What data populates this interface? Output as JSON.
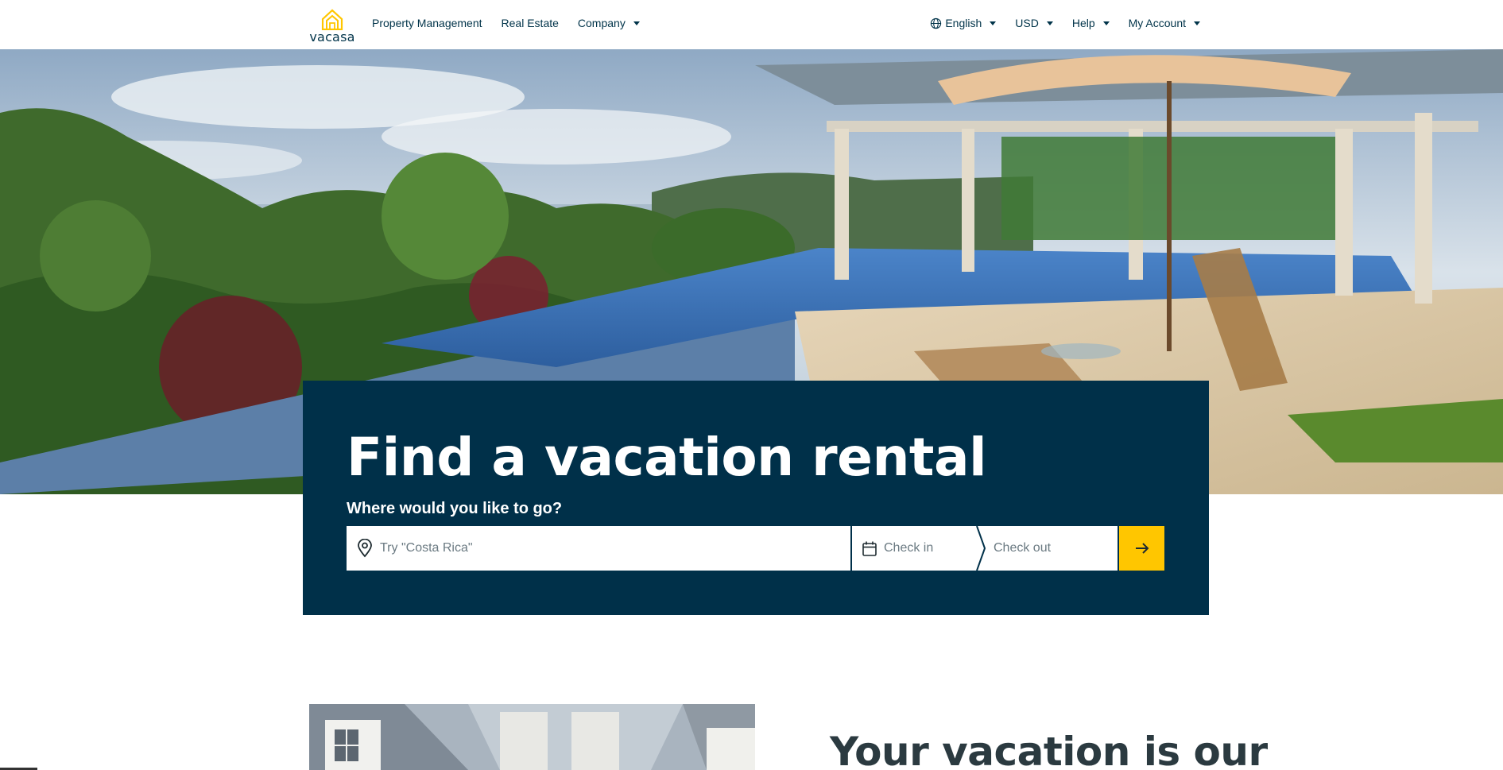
{
  "header": {
    "logo_text": "vacasa",
    "nav_left": [
      {
        "label": "Property Management",
        "dropdown": false
      },
      {
        "label": "Real Estate",
        "dropdown": false
      },
      {
        "label": "Company",
        "dropdown": true
      }
    ],
    "nav_right": [
      {
        "label": "English",
        "icon": "globe-icon",
        "dropdown": true
      },
      {
        "label": "USD",
        "dropdown": true
      },
      {
        "label": "Help",
        "dropdown": true
      },
      {
        "label": "My Account",
        "dropdown": true
      }
    ]
  },
  "search": {
    "title": "Find a vacation rental",
    "subtitle": "Where would you like to go?",
    "destination_placeholder": "Try \"Costa Rica\"",
    "checkin_label": "Check in",
    "checkout_label": "Check out",
    "submit_icon": "arrow-right-icon"
  },
  "section": {
    "heading": "Your vacation is our"
  },
  "colors": {
    "brand_navy": "#003049",
    "brand_yellow": "#ffc600",
    "text_navy": "#003349"
  }
}
